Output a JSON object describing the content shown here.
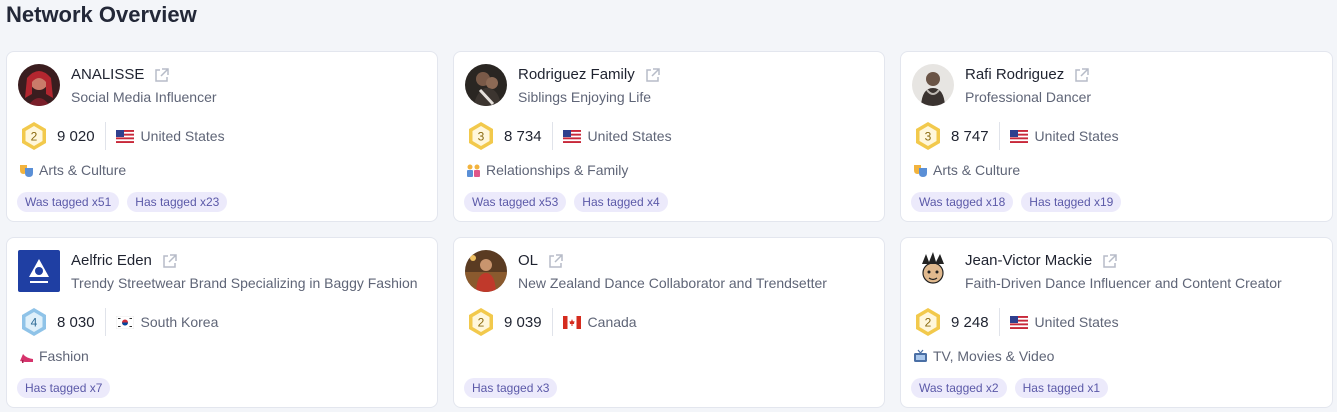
{
  "page": {
    "title": "Network Overview"
  },
  "colors": {
    "accent": "#5b59a8",
    "tag_bg": "#eceafb",
    "badge_gold": "#f2c94c",
    "badge_blue": "#8fc3e8"
  },
  "cards": [
    {
      "name": "ANALISSE",
      "subtitle": "Social Media Influencer",
      "level": "2",
      "score": "9 020",
      "flag": "us-flag",
      "country": "United States",
      "category_icon": "theater-masks-icon",
      "category": "Arts & Culture",
      "tags": [
        "Was tagged x51",
        "Has tagged x23"
      ]
    },
    {
      "name": "Rodriguez Family",
      "subtitle": "Siblings Enjoying Life",
      "level": "3",
      "score": "8 734",
      "flag": "us-flag",
      "country": "United States",
      "category_icon": "family-icon",
      "category": "Relationships & Family",
      "tags": [
        "Was tagged x53",
        "Has tagged x4"
      ]
    },
    {
      "name": "Rafi Rodriguez",
      "subtitle": "Professional Dancer",
      "level": "3",
      "score": "8 747",
      "flag": "us-flag",
      "country": "United States",
      "category_icon": "theater-masks-icon",
      "category": "Arts & Culture",
      "tags": [
        "Was tagged x18",
        "Has tagged x19"
      ]
    },
    {
      "name": "Aelfric Eden",
      "subtitle": "Trendy Streetwear Brand Specializing in Baggy Fashion",
      "level": "4",
      "score": "8 030",
      "flag": "kr-flag",
      "country": "South Korea",
      "category_icon": "high-heel-icon",
      "category": "Fashion",
      "tags": [
        "Has tagged x7"
      ]
    },
    {
      "name": "OL",
      "subtitle": "New Zealand Dance Collaborator and Trendsetter",
      "level": "2",
      "score": "9 039",
      "flag": "ca-flag",
      "country": "Canada",
      "category_icon": "",
      "category": "",
      "tags": [
        "Has tagged x3"
      ]
    },
    {
      "name": "Jean-Victor Mackie",
      "subtitle": "Faith-Driven Dance Influencer and Content Creator",
      "level": "2",
      "score": "9 248",
      "flag": "us-flag",
      "country": "United States",
      "category_icon": "tv-icon",
      "category": "TV, Movies & Video",
      "tags": [
        "Was tagged x2",
        "Has tagged x1"
      ]
    }
  ]
}
